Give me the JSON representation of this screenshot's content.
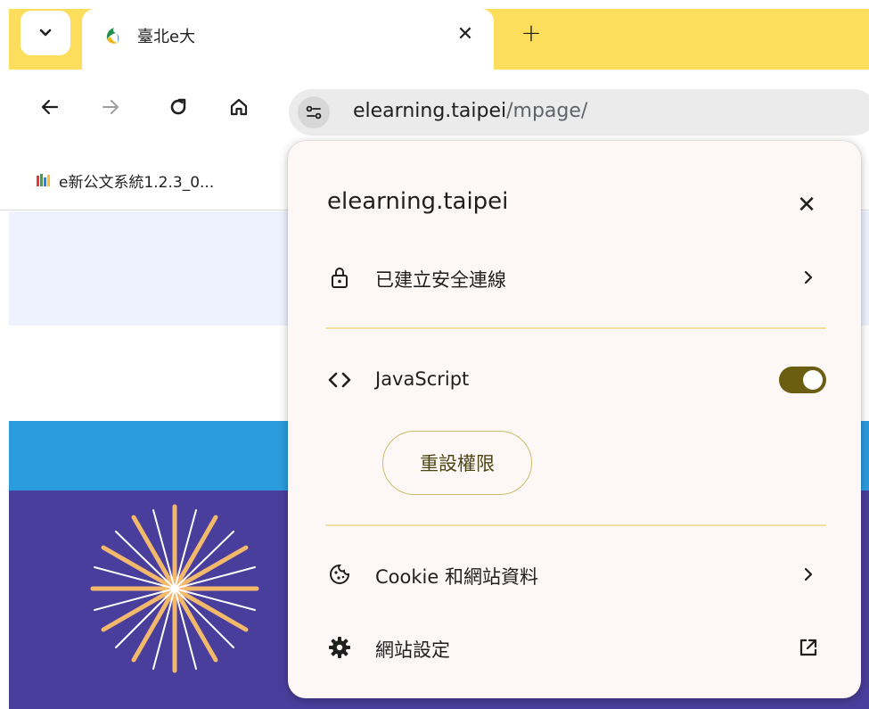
{
  "tabs": {
    "active_title": "臺北e大",
    "close_symbol": "✕",
    "new_tab_symbol": "+",
    "search_icon": "chevron-down-icon"
  },
  "toolbar": {
    "back_icon": "back-arrow-icon",
    "forward_icon": "forward-arrow-icon",
    "reload_icon": "reload-icon",
    "home_icon": "home-icon"
  },
  "omnibox": {
    "host": "elearning.taipei",
    "path": "/mpage/"
  },
  "bookmarks": [
    {
      "label": "e新公文系統1.2.3_0..."
    }
  ],
  "popup": {
    "title": "elearning.taipei",
    "close_symbol": "✕",
    "connection_label": "已建立安全連線",
    "javascript_label": "JavaScript",
    "javascript_enabled": true,
    "reset_button": "重設權限",
    "cookie_label": "Cookie 和網站資料",
    "site_settings_label": "網站設定"
  },
  "colors": {
    "tabstrip": "#fddd5c",
    "popup_bg": "#fdf8f6",
    "divider": "#f1dfa3",
    "toggle_on": "#6b5e10",
    "page_blue": "#2a9bdd",
    "page_purple": "#4a3e9c"
  }
}
